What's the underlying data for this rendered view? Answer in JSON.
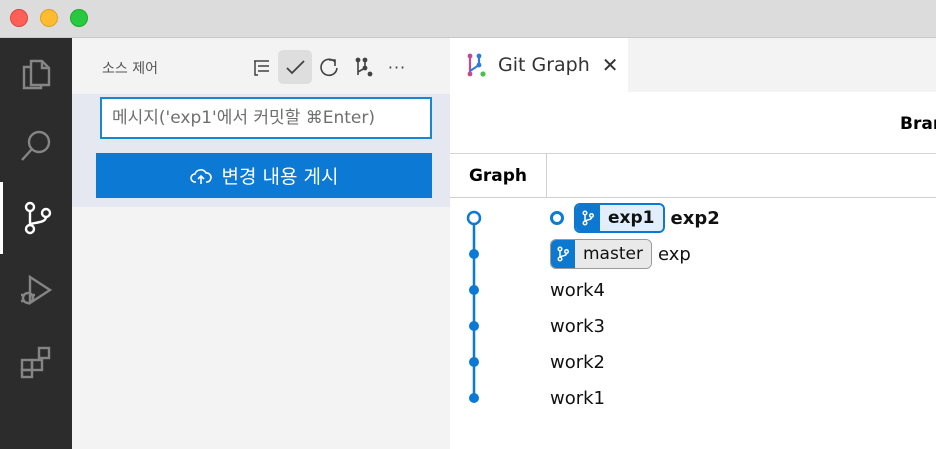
{
  "sidebar": {
    "title": "소스 제어",
    "commit_placeholder": "메시지('exp1'에서 커밋할 ⌘Enter)",
    "publish_label": "변경 내용 게시",
    "tools": [
      "tree-view-icon",
      "commit-check-icon",
      "refresh-icon",
      "git-graph-icon",
      "more-icon"
    ],
    "more_label": "···"
  },
  "activity_bar": [
    "explorer-icon",
    "search-icon",
    "source-control-icon",
    "run-debug-icon",
    "extensions-icon"
  ],
  "editor": {
    "tab_label": "Git Graph",
    "tab_close": "✕",
    "branches_label": "Bran",
    "columns": {
      "graph": "Graph"
    },
    "commits": [
      {
        "refs": [
          "exp1"
        ],
        "message": "exp2",
        "current": true
      },
      {
        "refs": [
          "master"
        ],
        "message": "exp",
        "current": false
      },
      {
        "refs": [],
        "message": "work4",
        "current": false
      },
      {
        "refs": [],
        "message": "work3",
        "current": false
      },
      {
        "refs": [],
        "message": "work2",
        "current": false
      },
      {
        "refs": [],
        "message": "work1",
        "current": false
      }
    ]
  },
  "colors": {
    "accent": "#0c7ad4",
    "activity_bar": "#2c2c2c",
    "sidebar": "#f3f3f3"
  }
}
